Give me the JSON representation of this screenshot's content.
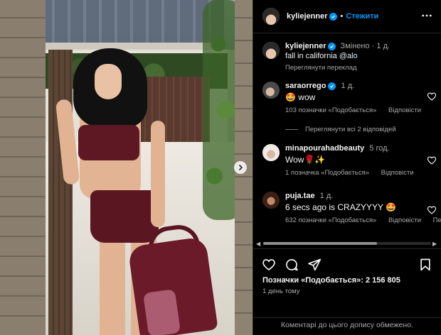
{
  "post": {
    "username": "kyliejenner",
    "follow_label": "Стежити",
    "header_dot": "•"
  },
  "caption": {
    "username": "kyliejenner",
    "edited": "Змінено",
    "time": "1 д.",
    "text": "fall in california ",
    "mention": "@alo",
    "translate": "Переглянути переклад"
  },
  "comments": [
    {
      "username": "saraorrego",
      "verified": true,
      "time": "1 д.",
      "text": "🤩 wow",
      "likes": "103 позначки «Подобається»",
      "reply": "Відповісти"
    },
    {
      "username": "minapourahadbeauty",
      "verified": false,
      "time": "5 год.",
      "text": "Wow🌹✨",
      "likes": "1 позначка «Подобається»",
      "reply": "Відповісти"
    },
    {
      "username": "puja.tae",
      "verified": false,
      "time": "1 д.",
      "text": "6 secs ago is CRAZYYYY 🤩",
      "likes": "632 позначки «Подобається»",
      "reply": "Відповісти",
      "extra": "Пе"
    }
  ],
  "view_replies": "Переглянути всі 2 відповідей",
  "actions": {
    "likes": "Позначки «Подобається»: 2 156 805",
    "time": "1 день тому",
    "restricted": "Коментарі до цього допису обмежено."
  },
  "icons": {
    "more": "more-horizontal-icon",
    "like": "heart-icon",
    "comment": "comment-icon",
    "share": "send-icon",
    "save": "bookmark-icon",
    "next": "chevron-right-icon"
  },
  "colors": {
    "accent": "#0095f6",
    "secondary_text": "#a8a8a8"
  }
}
